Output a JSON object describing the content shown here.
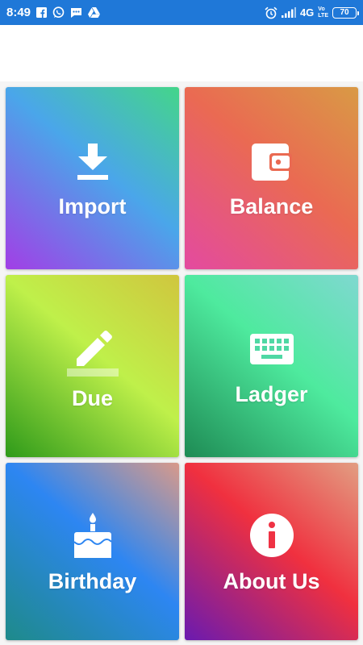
{
  "status_bar": {
    "time": "8:49",
    "network": "4G",
    "volte_top": "Vo",
    "volte_bottom": "LTE",
    "battery": "70",
    "left_icons": [
      "facebook-icon",
      "whatsapp-icon",
      "message-icon",
      "drive-icon"
    ],
    "right_icons": [
      "alarm-icon",
      "signal-icon",
      "battery-icon"
    ],
    "color": "#1f78d8"
  },
  "tiles": [
    {
      "label": "Import",
      "icon": "download-icon"
    },
    {
      "label": "Balance",
      "icon": "wallet-icon"
    },
    {
      "label": "Due",
      "icon": "pencil-icon"
    },
    {
      "label": "Ladger",
      "icon": "keyboard-icon"
    },
    {
      "label": "Birthday",
      "icon": "cake-icon"
    },
    {
      "label": "About Us",
      "icon": "info-icon"
    }
  ]
}
